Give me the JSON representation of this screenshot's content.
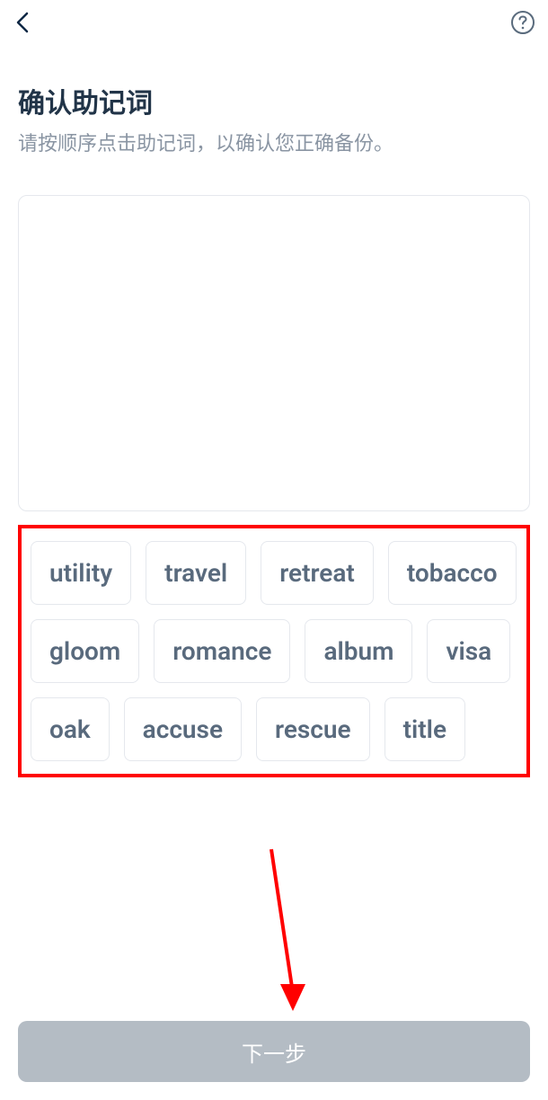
{
  "header": {
    "back_icon": "back-icon",
    "help_icon": "help-icon"
  },
  "title": "确认助记词",
  "subtitle": "请按顺序点击助记词，以确认您正确备份。",
  "mnemonic_words": [
    "utility",
    "travel",
    "retreat",
    "tobacco",
    "gloom",
    "romance",
    "album",
    "visa",
    "oak",
    "accuse",
    "rescue",
    "title"
  ],
  "next_button_label": "下一步",
  "annotations": {
    "word_box_highlight": true,
    "arrow_to_next": true
  }
}
